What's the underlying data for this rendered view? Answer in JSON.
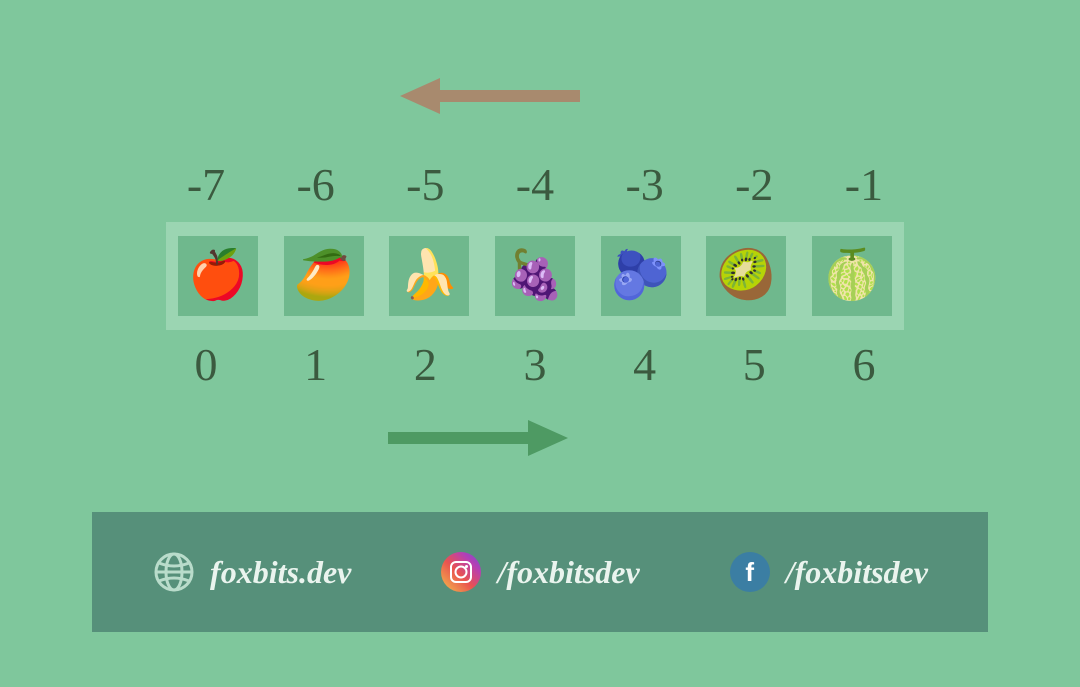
{
  "negative_indices": [
    "-7",
    "-6",
    "-5",
    "-4",
    "-3",
    "-2",
    "-1"
  ],
  "positive_indices": [
    "0",
    "1",
    "2",
    "3",
    "4",
    "5",
    "6"
  ],
  "fruits": [
    {
      "name": "apple",
      "glyph": "🍎"
    },
    {
      "name": "mango",
      "glyph": "🥭"
    },
    {
      "name": "banana",
      "glyph": "🍌"
    },
    {
      "name": "grapes",
      "glyph": "🍇"
    },
    {
      "name": "blueberry",
      "glyph": "🫐"
    },
    {
      "name": "kiwi",
      "glyph": "🥝"
    },
    {
      "name": "papaya",
      "glyph": "🍈"
    }
  ],
  "arrows": {
    "top_direction": "left",
    "top_color": "#a88a6e",
    "bottom_direction": "right",
    "bottom_color": "#4e9a63"
  },
  "footer": {
    "website": "foxbits.dev",
    "instagram": "/foxbitsdev",
    "facebook": "/foxbitsdev"
  }
}
